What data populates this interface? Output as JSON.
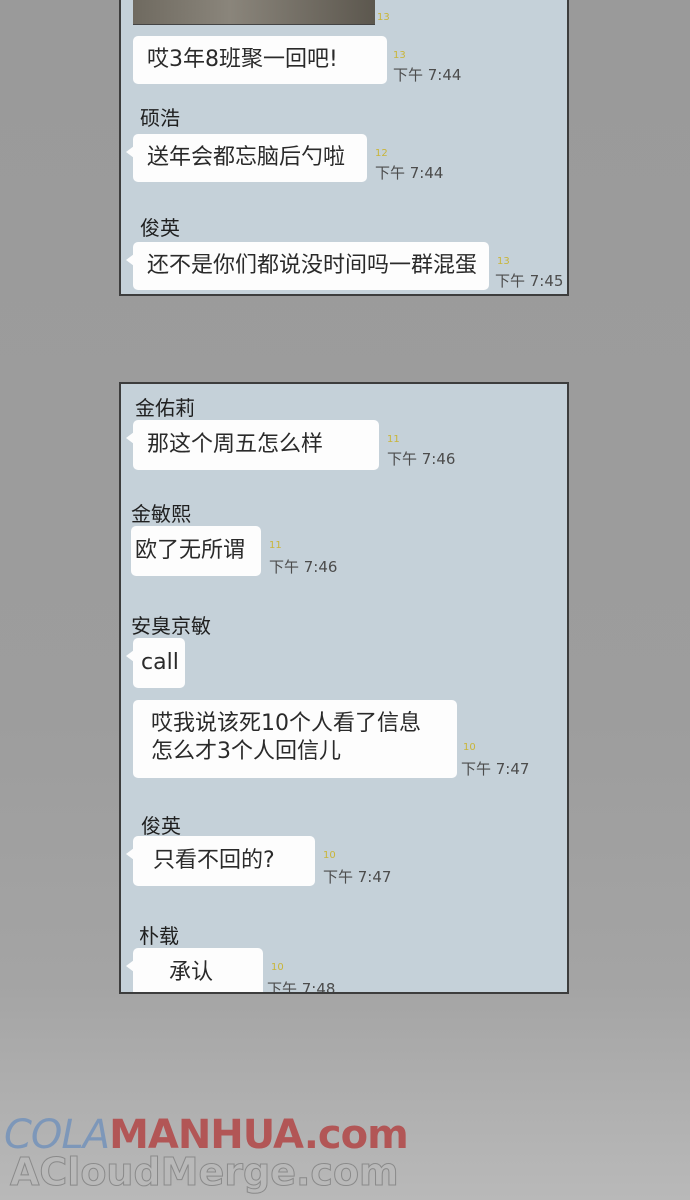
{
  "top_panel": {
    "messages": [
      {
        "sender": "",
        "text": "哎3年8班聚一回吧!",
        "unread": "13",
        "time": "下午 7:44"
      },
      {
        "sender": "硕浩",
        "text": "送年会都忘脑后勺啦",
        "unread": "12",
        "time": "下午 7:44"
      },
      {
        "sender": "俊英",
        "text": "还不是你们都说没时间吗一群混蛋",
        "unread": "13",
        "time": "下午 7:45"
      }
    ]
  },
  "bottom_panel": {
    "messages": [
      {
        "sender": "金佑莉",
        "text": "那这个周五怎么样",
        "unread": "11",
        "time": "下午 7:46"
      },
      {
        "sender": "金敏熙",
        "text": "欧了无所谓",
        "unread": "11",
        "time": "下午 7:46"
      },
      {
        "sender": "安臭京敏",
        "text": "call",
        "unread": "",
        "time": ""
      },
      {
        "sender": "",
        "text_line1": "哎我说该死10个人看了信息",
        "text_line2": "怎么才3个人回信儿",
        "unread": "10",
        "time": "下午 7:47"
      },
      {
        "sender": "俊英",
        "text": "只看不回的?",
        "unread": "10",
        "time": "下午 7:47"
      },
      {
        "sender": "朴载",
        "text": "承认",
        "unread": "10",
        "time": "下午 7:48"
      }
    ]
  },
  "watermark": {
    "part1": "COLA",
    "part2": "MANHUA",
    "part3": ".com",
    "line2": "ACloudMerge.com"
  }
}
